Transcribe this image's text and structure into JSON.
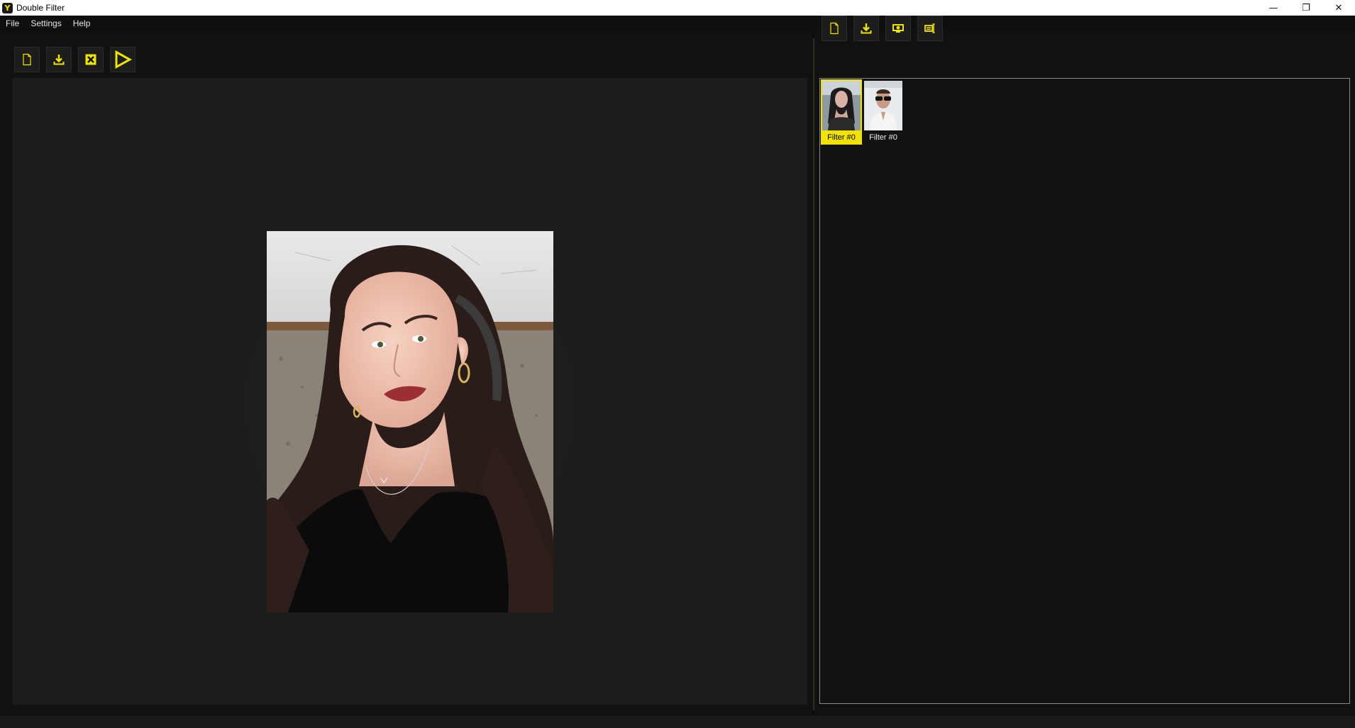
{
  "window": {
    "title": "Double Filter",
    "app_icon": "Y",
    "controls": {
      "minimize": "—",
      "restore": "❐",
      "close": "✕"
    }
  },
  "menu": {
    "items": [
      {
        "label": "File"
      },
      {
        "label": "Settings"
      },
      {
        "label": "Help"
      }
    ]
  },
  "left_toolbar": {
    "buttons": [
      "new-file-icon",
      "download-icon",
      "clear-icon",
      "play-icon"
    ]
  },
  "right_toolbar": {
    "buttons": [
      "new-file-icon",
      "download-icon",
      "webcam-capture-icon",
      "batch-process-icon"
    ]
  },
  "gallery": {
    "items": [
      {
        "label": "Filter #0",
        "selected": true,
        "thumb": "woman-portrait"
      },
      {
        "label": "Filter #0",
        "selected": false,
        "thumb": "man-sunglasses"
      }
    ]
  },
  "colors": {
    "accent": "#f2e200",
    "background": "#111111",
    "canvas": "#1c1c1c"
  }
}
